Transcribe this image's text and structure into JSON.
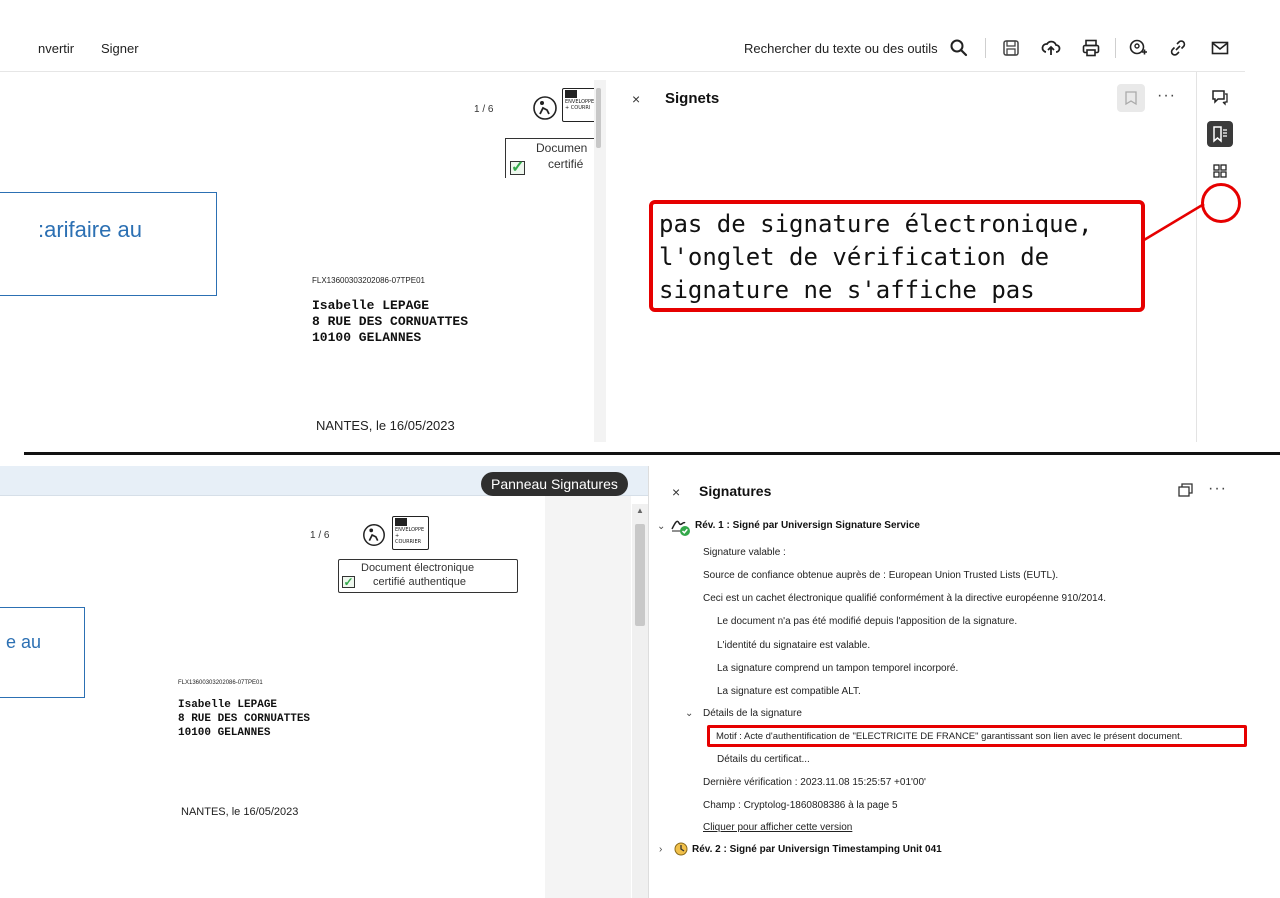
{
  "top": {
    "toolbar": {
      "convert_label": "nvertir",
      "sign_label": "Signer",
      "search_label": "Rechercher du texte ou des outils",
      "icons": [
        "search-icon",
        "save-icon",
        "upload-cloud-icon",
        "print-icon",
        "sign-user-icon",
        "link-icon",
        "mail-icon"
      ]
    },
    "document": {
      "page_indicator": "1 / 6",
      "envelope_line1": "ENVELOPPE",
      "envelope_line2": "+ COURRI",
      "certified_line1": "Documen",
      "certified_line2": "certifié",
      "blue_box_text": ":arifaire au",
      "ref_code": "FLX13600303202086-07TPE01",
      "address": [
        "Isabelle LEPAGE",
        "8 RUE DES CORNUATTES",
        "10100 GELANNES"
      ],
      "city_date": "NANTES, le 16/05/2023"
    },
    "bookmarks_panel": {
      "close": "×",
      "title": "Signets",
      "more": "···"
    },
    "annotation": {
      "lines": [
        "pas de signature électronique,",
        "l'onglet de vérification de",
        "signature ne s'affiche pas"
      ],
      "color": "#e60000"
    },
    "rail_icons": [
      "comment-icon",
      "bookmark-icon",
      "grid-icon"
    ]
  },
  "bottom": {
    "pill_label": "Panneau Signatures",
    "document": {
      "page_indicator": "1 / 6",
      "envelope_line1": "ENVELOPPE",
      "envelope_line2": "+ COURRIER",
      "certified_line1": "Document électronique",
      "certified_line2": "certifié authentique",
      "blue_box_text": "e au",
      "ref_code": "FLX13600303202086-07TPE01",
      "address": [
        "Isabelle LEPAGE",
        "8 RUE DES CORNUATTES",
        "10100 GELANNES"
      ],
      "city_date": "NANTES, le 16/05/2023"
    },
    "signatures_panel": {
      "close": "×",
      "title": "Signatures",
      "more": "···",
      "rev1": "Rév. 1 : Signé par Universign Signature Service",
      "valid": "Signature valable :",
      "trust_source": "Source de confiance obtenue auprès de : European Union Trusted Lists (EUTL).",
      "qualified_seal": "Ceci est un cachet électronique qualifié conformément à la directive européenne 910/2014.",
      "not_modified": "Le document n'a pas été modifié depuis l'apposition de la signature.",
      "identity_valid": "L'identité du signataire est valable.",
      "timestamp": "La signature comprend un tampon temporel incorporé.",
      "alt_compat": "La signature est compatible ALT.",
      "details_header": "Détails de la signature",
      "motif": "Motif : Acte d'authentification de \"ELECTRICITE  DE FRANCE\" garantissant son lien avec le présent document.",
      "cert_details": "Détails du certificat...",
      "last_check": "Dernière vérification : 2023.11.08 15:25:57 +01'00'",
      "field": "Champ : Cryptolog-1860808386 à la page 5",
      "show_version": "Cliquer pour afficher cette version",
      "rev2": "Rév. 2 : Signé par Universign Timestamping Unit 041"
    }
  }
}
